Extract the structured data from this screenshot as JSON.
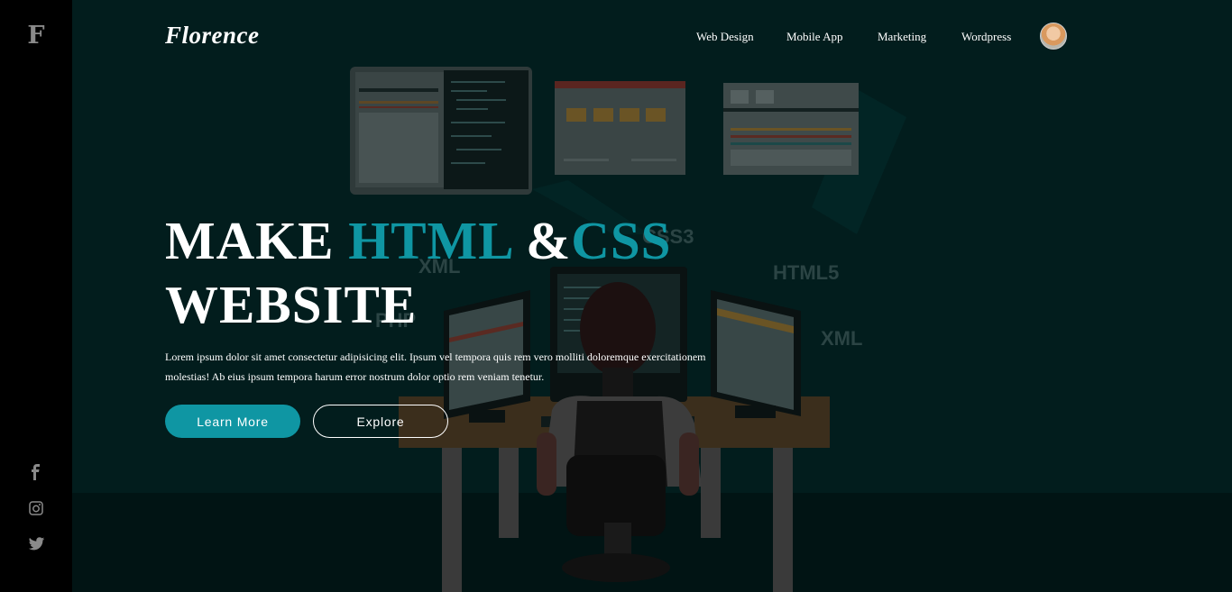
{
  "sidebar": {
    "logo_letter": "F",
    "social": [
      "facebook-icon",
      "instagram-icon",
      "twitter-icon"
    ]
  },
  "header": {
    "brand": "Florence",
    "nav": [
      "Web Design",
      "Mobile App",
      "Marketing",
      "Wordpress"
    ]
  },
  "hero": {
    "headline_part1": "MAKE ",
    "headline_accent1": "HTML",
    "headline_amp": " &",
    "headline_accent2": "CSS",
    "headline_line2": "WEBSITE",
    "description": "Lorem ipsum dolor sit amet consectetur adipisicing elit. Ipsum vel tempora quis rem vero molliti doloremque exercitationem molestias! Ab eius ipsum tempora harum error nostrum dolor optio rem veniam tenetur.",
    "primary_button": "Learn More",
    "secondary_button": "Explore"
  },
  "illustration": {
    "labels": [
      "CSS3",
      "XML",
      "HTML5",
      "PHP",
      "XML"
    ]
  },
  "colors": {
    "accent": "#0f96a3",
    "background": "#021d1d",
    "sidebar": "#000000"
  }
}
